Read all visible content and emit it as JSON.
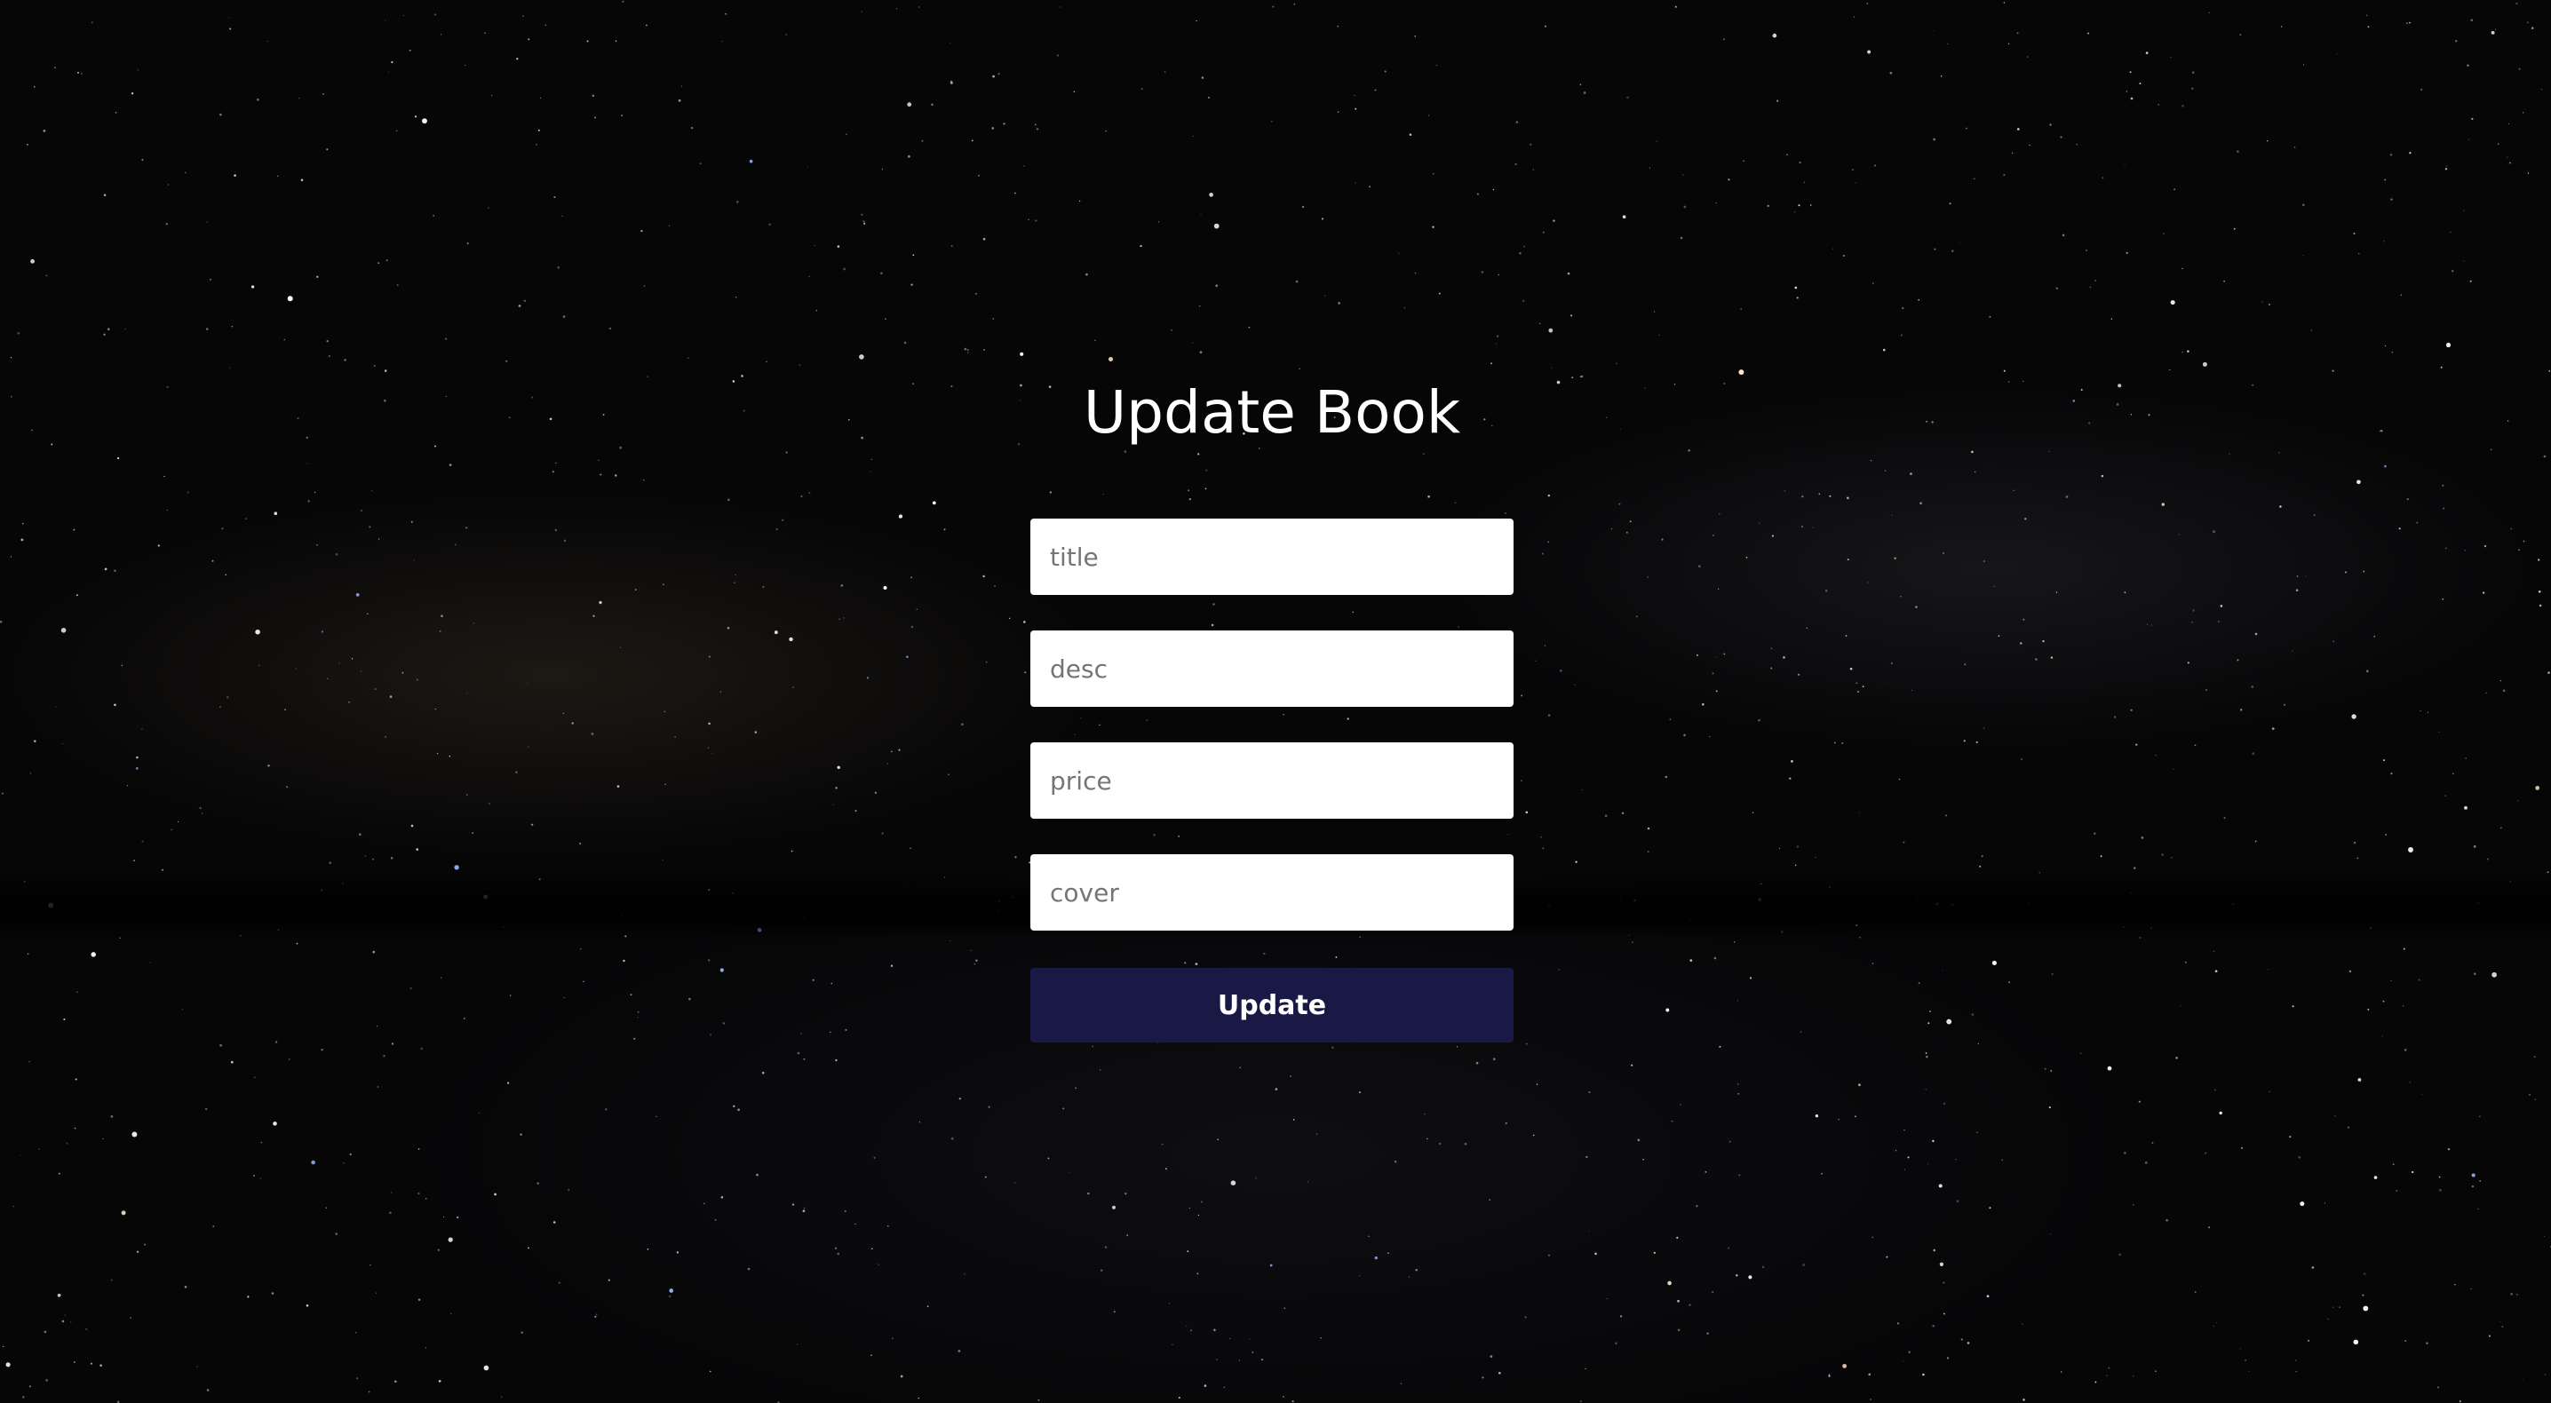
{
  "page": {
    "title": "Update Book"
  },
  "form": {
    "fields": [
      {
        "name": "title",
        "placeholder": "title",
        "value": ""
      },
      {
        "name": "desc",
        "placeholder": "desc",
        "value": ""
      },
      {
        "name": "price",
        "placeholder": "price",
        "value": ""
      },
      {
        "name": "cover",
        "placeholder": "cover",
        "value": ""
      }
    ],
    "submit_label": "Update"
  },
  "colors": {
    "background": "#060607",
    "button": "#1a1845",
    "title_text": "#ffffff",
    "field_background": "#ffffff",
    "placeholder_text": "#757575"
  }
}
